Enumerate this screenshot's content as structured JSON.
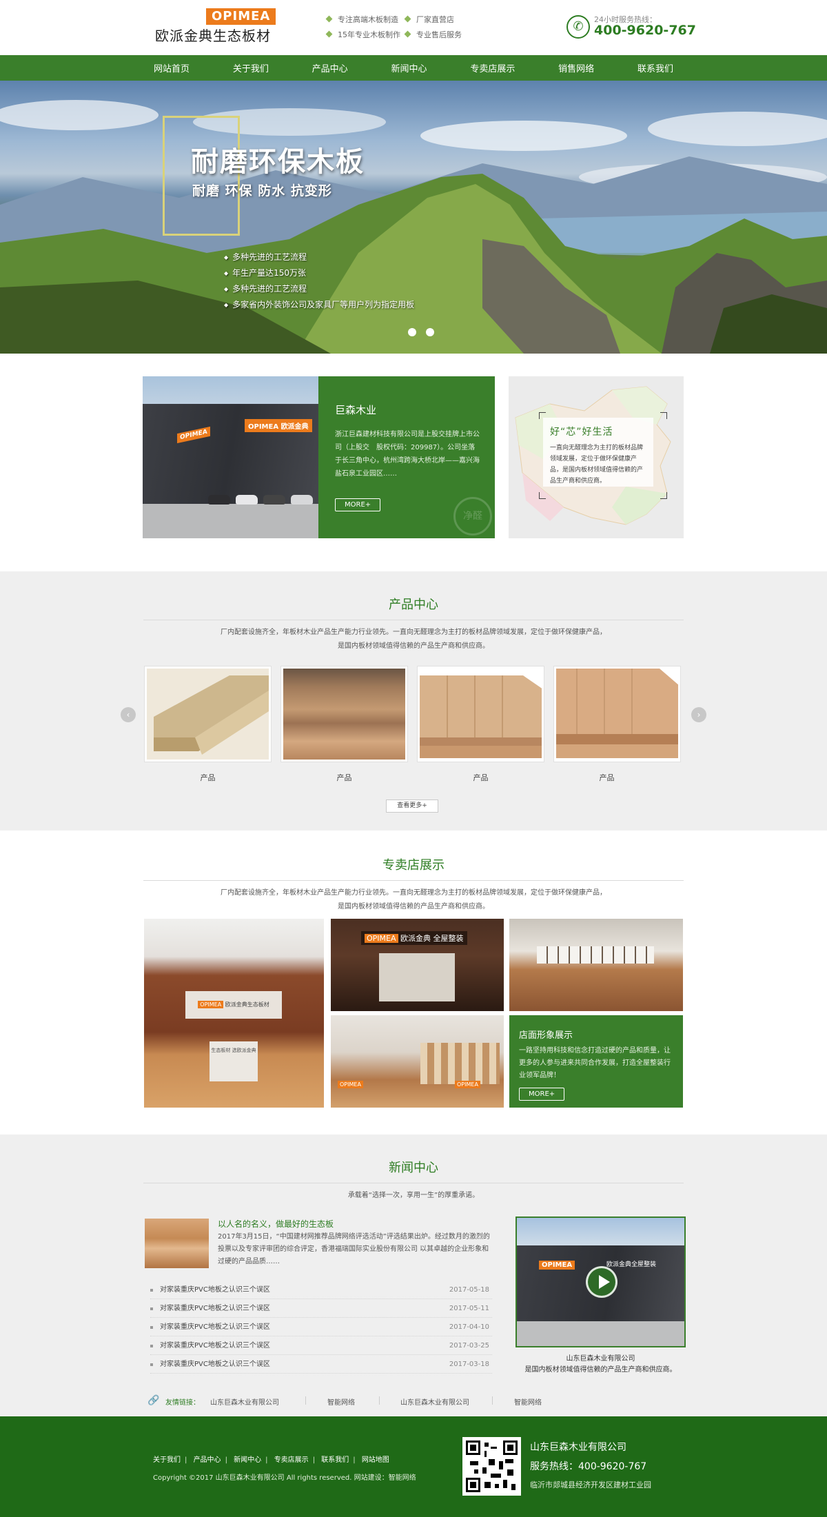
{
  "header": {
    "logo_badge": "OPIMEA",
    "logo_name": "欧派金典生态板材",
    "features": [
      "专注高端木板制造",
      "厂家直营店",
      "15年专业木板制作",
      "专业售后服务"
    ],
    "hotline_label": "24小时服务热线：",
    "hotline_number": "400-9620-767"
  },
  "nav": [
    "网站首页",
    "关于我们",
    "产品中心",
    "新闻中心",
    "专卖店展示",
    "销售网络",
    "联系我们"
  ],
  "banner": {
    "title": "耐磨环保木板",
    "subtitle": "耐磨 环保 防水 抗变形",
    "bullets": [
      "多种先进的工艺流程",
      "年生产量达150万张",
      "多种先进的工艺流程",
      "多家省内外装饰公司及家具厂等用户列为指定用板"
    ],
    "slides": 2
  },
  "about": {
    "photo_sign": "OPIMEA",
    "photo_sign_cn": "欧派金典",
    "title": "巨森木业",
    "text": "浙江巨森建材科技有限公司是上股交挂牌上市公司（上股交　股权代码：209987）。公司坐落于长三角中心，杭州湾跨海大桥北岸——嘉兴海盐石泉工业园区……",
    "more": "MORE+",
    "stamp": "净醛",
    "map_title": "好“芯”好生活",
    "map_text": "一直向无醛理念为主打的板材品牌领域发展，定位于做环保健康产品，是国内板材领域值得信赖的产品生产商和供应商。"
  },
  "products": {
    "title": "产品中心",
    "desc": "厂内配套设施齐全，年板材木业产品生产能力行业领先。一直向无醛理念为主打的板材品牌领域发展，定位于做环保健康产品，是国内板材领域值得信赖的产品生产商和供应商。",
    "items": [
      {
        "label": "产品"
      },
      {
        "label": "产品"
      },
      {
        "label": "产品"
      },
      {
        "label": "产品"
      }
    ],
    "prev": "‹",
    "next": "›",
    "more": "查看更多+"
  },
  "store": {
    "title": "专卖店展示",
    "desc": "厂内配套设施齐全，年板材木业产品生产能力行业领先。一直向无醛理念为主打的板材品牌领域发展，定位于做环保健康产品，是国内板材领域值得信赖的产品生产商和供应商。",
    "sign_brand": "OPIMEA",
    "sign_name": "欧派金典生态板材",
    "sign_full": "欧派金典 全屋整装",
    "counter_text": "生态板材 选欧派金典",
    "card_title": "店面形象展示",
    "card_text": "一路坚持用科技和信念打造过硬的产品和质量，让更多的人参与进来共同合作发展，打造全屋整装行业领军品牌！",
    "more": "MORE+"
  },
  "news": {
    "title": "新闻中心",
    "tagline": "承载着“选择一次，享用一生”的厚重承诺。",
    "featured_title": "以人名的名义，做最好的生态板",
    "featured_text": "2017年3月15日，“中国建材网推荐品牌网络评选活动”评选结果出炉。经过数月的激烈的投票以及专家评审团的综合评定，香港福瑞国际实业股份有限公司 以其卓越的企业形象和过硬的产品品质……",
    "items": [
      {
        "title": "对家装重庆PVC地板之认识三个误区",
        "date": "2017-05-18"
      },
      {
        "title": "对家装重庆PVC地板之认识三个误区",
        "date": "2017-05-11"
      },
      {
        "title": "对家装重庆PVC地板之认识三个误区",
        "date": "2017-04-10"
      },
      {
        "title": "对家装重庆PVC地板之认识三个误区",
        "date": "2017-03-25"
      },
      {
        "title": "对家装重庆PVC地板之认识三个误区",
        "date": "2017-03-18"
      }
    ],
    "video_company": "山东巨森木业有限公司",
    "video_caption": "是国内板材领域值得信赖的产品生产商和供应商。",
    "video_sign": "OPIMEA",
    "video_sign_cn": "欧派金典全屋整装",
    "links_label": "友情链接：",
    "links": [
      "山东巨森木业有限公司",
      "智能网络",
      "山东巨森木业有限公司",
      "智能网络"
    ]
  },
  "footer": {
    "nav": [
      "关于我们",
      "产品中心",
      "新闻中心",
      "专卖店展示",
      "联系我们",
      "网站地图"
    ],
    "copyright": "Copyright ©2017  山东巨森木业有限公司 All rights reserved.  网站建设：智能网络",
    "company": "山东巨森木业有限公司",
    "hotline": "服务热线：400-9620-767",
    "address": "临沂市郯城县经济开发区建材工业园"
  },
  "colors": {
    "brand_green": "#3a7f2b",
    "footer_green": "#1f6a17",
    "logo_orange": "#ec7b1c"
  }
}
